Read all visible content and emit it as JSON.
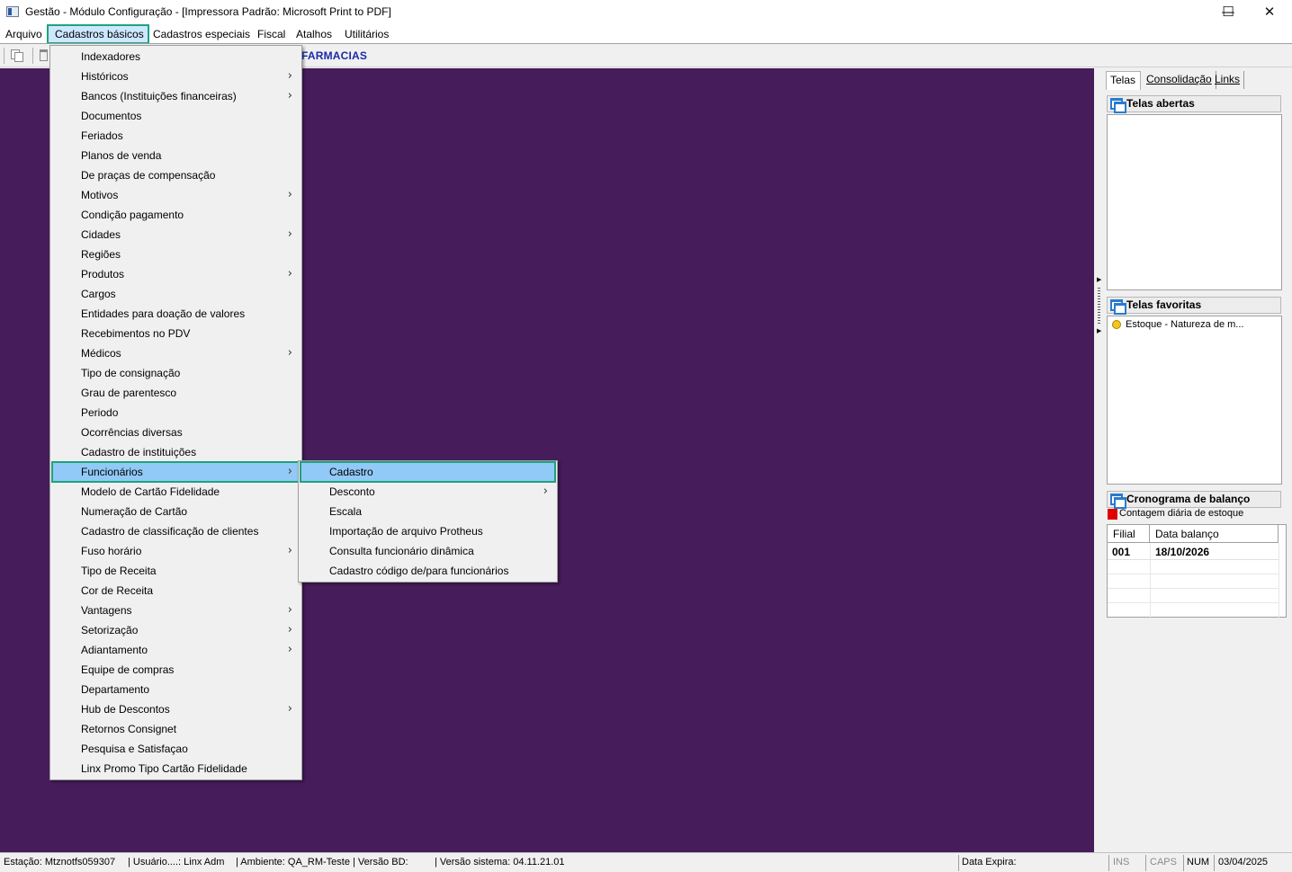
{
  "window": {
    "title": "Gestão  - Módulo Configuração - [Impressora Padrão: Microsoft Print to PDF]",
    "minimize": "—",
    "maximize": "☐",
    "close": "✕"
  },
  "menubar": [
    {
      "label": "Arquivo"
    },
    {
      "label": "Cadastros básicos",
      "active": true
    },
    {
      "label": "Cadastros especiais"
    },
    {
      "label": "Fiscal"
    },
    {
      "label": "Atalhos"
    },
    {
      "label": "Utilitários"
    }
  ],
  "toolbar": {
    "company_label": "FARMACIAS"
  },
  "cadastros_menu": [
    {
      "label": "Indexadores"
    },
    {
      "label": "Históricos",
      "submenu": true
    },
    {
      "label": "Bancos (Instituições financeiras)",
      "submenu": true
    },
    {
      "label": "Documentos"
    },
    {
      "label": "Feriados"
    },
    {
      "label": "Planos de venda"
    },
    {
      "label": "De praças de compensação"
    },
    {
      "label": "Motivos",
      "submenu": true
    },
    {
      "label": "Condição pagamento"
    },
    {
      "label": "Cidades",
      "submenu": true
    },
    {
      "label": "Regiões"
    },
    {
      "label": "Produtos",
      "submenu": true
    },
    {
      "label": "Cargos"
    },
    {
      "label": "Entidades para doação de valores"
    },
    {
      "label": "Recebimentos no PDV"
    },
    {
      "label": "Médicos",
      "submenu": true
    },
    {
      "label": "Tipo de consignação"
    },
    {
      "label": "Grau de parentesco"
    },
    {
      "label": "Periodo"
    },
    {
      "label": "Ocorrências diversas"
    },
    {
      "label": "Cadastro de instituições"
    },
    {
      "label": "Funcionários",
      "submenu": true,
      "highlighted": true
    },
    {
      "label": "Modelo de Cartão Fidelidade"
    },
    {
      "label": "Numeração de Cartão"
    },
    {
      "label": "Cadastro de classificação de clientes"
    },
    {
      "label": "Fuso horário",
      "submenu": true
    },
    {
      "label": "Tipo de Receita"
    },
    {
      "label": "Cor de Receita"
    },
    {
      "label": "Vantagens",
      "submenu": true
    },
    {
      "label": "Setorização",
      "submenu": true
    },
    {
      "label": "Adiantamento",
      "submenu": true
    },
    {
      "label": "Equipe de compras"
    },
    {
      "label": "Departamento"
    },
    {
      "label": "Hub de Descontos",
      "submenu": true
    },
    {
      "label": "Retornos Consignet"
    },
    {
      "label": "Pesquisa e Satisfaçao"
    },
    {
      "label": "Linx Promo Tipo Cartão Fidelidade"
    }
  ],
  "funcionarios_menu": [
    {
      "label": "Cadastro",
      "highlighted": true
    },
    {
      "label": "Desconto",
      "submenu": true
    },
    {
      "label": "Escala"
    },
    {
      "label": "Importação de arquivo Protheus"
    },
    {
      "label": "Consulta funcionário dinâmica"
    },
    {
      "label": "Cadastro código de/para funcionários"
    }
  ],
  "submenu_arrow": "›",
  "right_panel": {
    "tabs": [
      {
        "label": "Telas",
        "active": true
      },
      {
        "label": "Consolidação"
      },
      {
        "label": "Links"
      }
    ],
    "telas_abertas": "Telas abertas",
    "telas_favoritas": "Telas favoritas",
    "favorites": [
      "Estoque - Natureza de m..."
    ],
    "cronograma": {
      "title": "Cronograma de balanço",
      "legend": "Contagem diária de estoque",
      "legend_color": "#e00000",
      "columns": [
        "Filial",
        "Data balanço"
      ],
      "rows": [
        [
          "001",
          "18/10/2026"
        ]
      ]
    }
  },
  "statusbar": {
    "estacao": "Estação: Mtznotfs059307",
    "usuario": "| Usuário....: Linx Adm",
    "ambiente": "| Ambiente: QA_RM-Teste | Versão BD:",
    "versao_sistema": "| Versão sistema: 04.11.21.01",
    "data_expira": "Data Expira:",
    "ins": "INS",
    "caps": "CAPS",
    "num": "NUM",
    "date": "03/04/2025"
  },
  "colors": {
    "workarea": "#461c5b",
    "highlight": "#91c9f7",
    "focus_outline": "#1fa37b",
    "company_label": "#1a2aa8"
  }
}
